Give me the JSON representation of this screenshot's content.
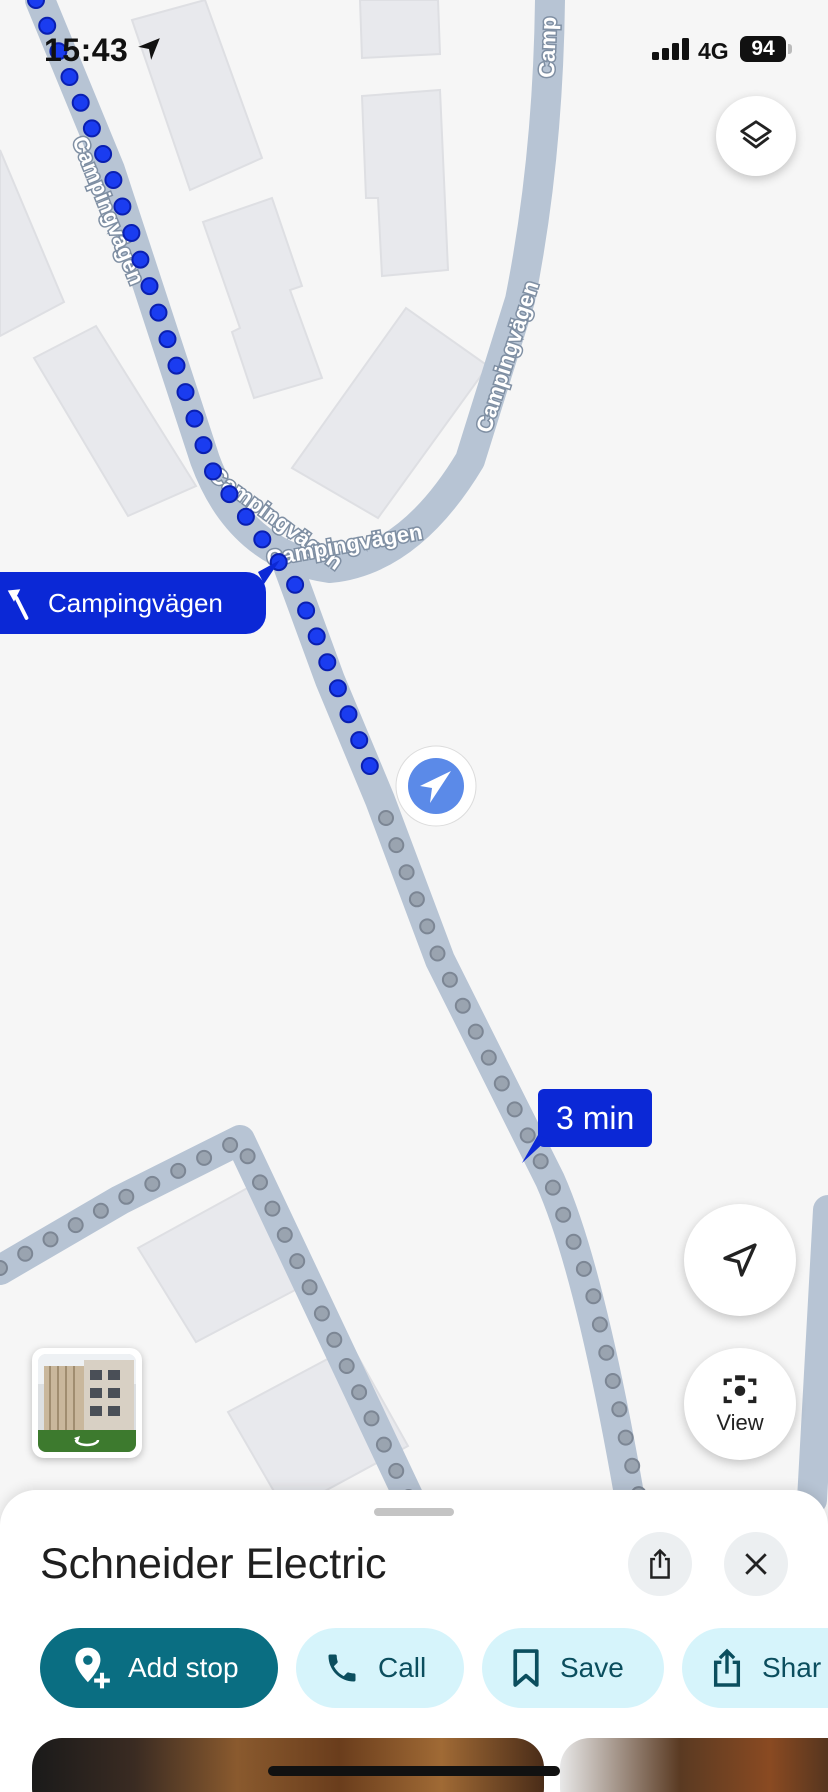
{
  "status_bar": {
    "time": "15:43",
    "network": "4G",
    "battery": "94"
  },
  "map": {
    "street_labels": [
      "Campingvägen",
      "Campingvägen",
      "Campingvägen",
      "Camp"
    ],
    "turn_instruction": "Campingvägen",
    "eta": "3 min",
    "route_color": "#1a3cf0",
    "remaining_color": "#9aa4b0"
  },
  "controls": {
    "view_label": "View"
  },
  "place": {
    "title": "Schneider Electric",
    "actions": [
      {
        "label": "Add stop",
        "icon": "add-location-icon"
      },
      {
        "label": "Call",
        "icon": "phone-icon"
      },
      {
        "label": "Save",
        "icon": "bookmark-icon"
      },
      {
        "label": "Shar",
        "icon": "share-icon"
      }
    ]
  },
  "colors": {
    "accent": "#0a6e82",
    "chip_light": "#d6f4fb",
    "label_blue": "#0b28d6"
  }
}
